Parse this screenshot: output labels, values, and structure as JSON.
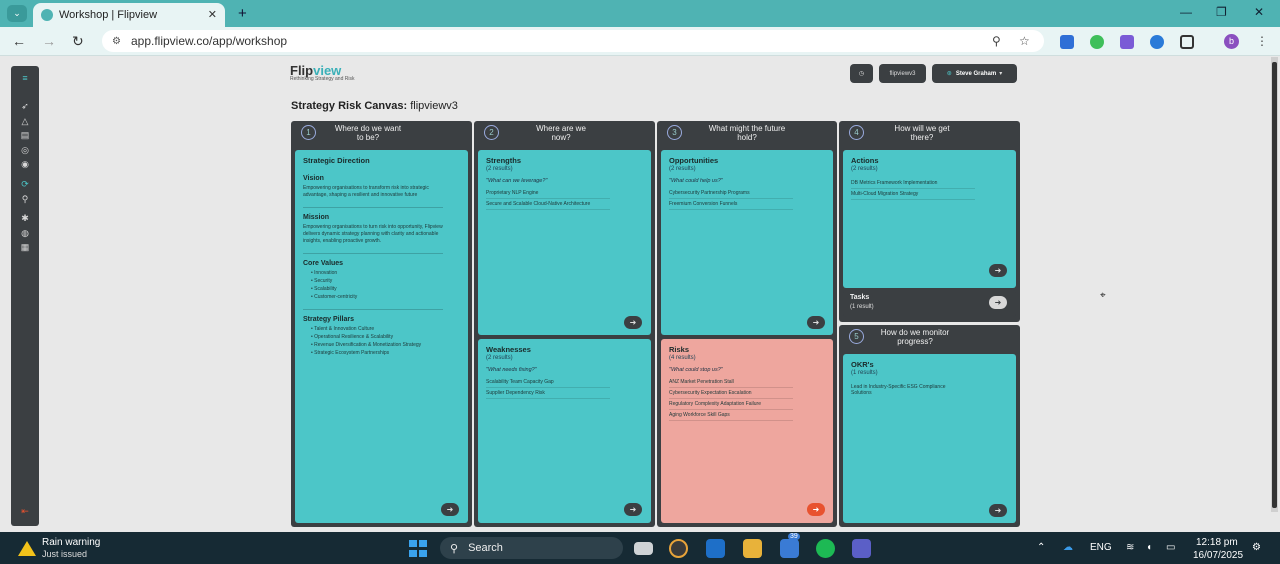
{
  "browser": {
    "tab_title": "Workshop | Flipview",
    "url": "app.flipview.co/app/workshop",
    "profile_initial": "b"
  },
  "header": {
    "logo_prefix": "Flip",
    "logo_suffix": "view",
    "tagline": "Rethinking Strategy and Risk",
    "workshop_chip": "flipviewv3",
    "user_name": "Steve Graham"
  },
  "page": {
    "title_bold": "Strategy Risk Canvas:",
    "title_rest": "flipviewv3"
  },
  "columns": [
    {
      "num": "1",
      "question": "Where do we want to be?"
    },
    {
      "num": "2",
      "question": "Where are we now?"
    },
    {
      "num": "3",
      "question": "What might the future hold?"
    },
    {
      "num": "4",
      "question": "How will we get there?"
    },
    {
      "num": "5",
      "question": "How do we monitor progress?"
    }
  ],
  "strategic": {
    "title": "Strategic Direction",
    "vision_title": "Vision",
    "vision_text": "Empowering organisations to transform risk into strategic advantage, shaping a resilient and innovative future",
    "mission_title": "Mission",
    "mission_text": "Empowering organisations to turn risk into opportunity, Flipview delivers dynamic strategy planning with clarity and actionable insights, enabling proactive growth.",
    "values_title": "Core Values",
    "values": [
      "Innovation",
      "Security",
      "Scalability",
      "Customer-centricity"
    ],
    "pillars_title": "Strategy Pillars",
    "pillars": [
      "Talent & Innovation Culture",
      "Operational Resilience & Scalability",
      "Revenue Diversification & Monetization Strategy",
      "Strategic Ecosystem Partnerships"
    ]
  },
  "strengths": {
    "title": "Strengths",
    "count": "(2 results)",
    "prompt": "\"What can we leverage?\"",
    "items": [
      "Proprietary NLP Engine",
      "Secure and Scalable Cloud-Native Architecture"
    ]
  },
  "weaknesses": {
    "title": "Weaknesses",
    "count": "(2 results)",
    "prompt": "\"What needs fixing?\"",
    "items": [
      "Scalability Team Capacity Gap",
      "Supplier Dependency Risk"
    ]
  },
  "opportunities": {
    "title": "Opportunities",
    "count": "(2 results)",
    "prompt": "\"What could help us?\"",
    "items": [
      "Cybersecurity Partnership Programs",
      "Freemium Conversion Funnels"
    ]
  },
  "risks": {
    "title": "Risks",
    "count": "(4 results)",
    "prompt": "\"What could stop us?\"",
    "items": [
      "ANZ Market Penetration Stall",
      "Cybersecurity Expectation Escalation",
      "Regulatory Complexity Adaptation Failure",
      "Aging Workforce Skill Gaps"
    ]
  },
  "actions": {
    "title": "Actions",
    "count": "(2 results)",
    "items": [
      "DB Metrics Framework Implementation",
      "Multi-Cloud Migration Strategy"
    ]
  },
  "tasks": {
    "title": "Tasks",
    "count": "(1 result)"
  },
  "okrs": {
    "title": "OKR's",
    "count": "(1 results)",
    "items": [
      "Lead in Industry-Specific ESG Compliance Solutions"
    ]
  },
  "taskbar": {
    "weather_title": "Rain warning",
    "weather_sub": "Just issued",
    "search_label": "Search",
    "badge_count": "39",
    "lang": "ENG",
    "time": "12:18 pm",
    "date": "16/07/2025"
  }
}
